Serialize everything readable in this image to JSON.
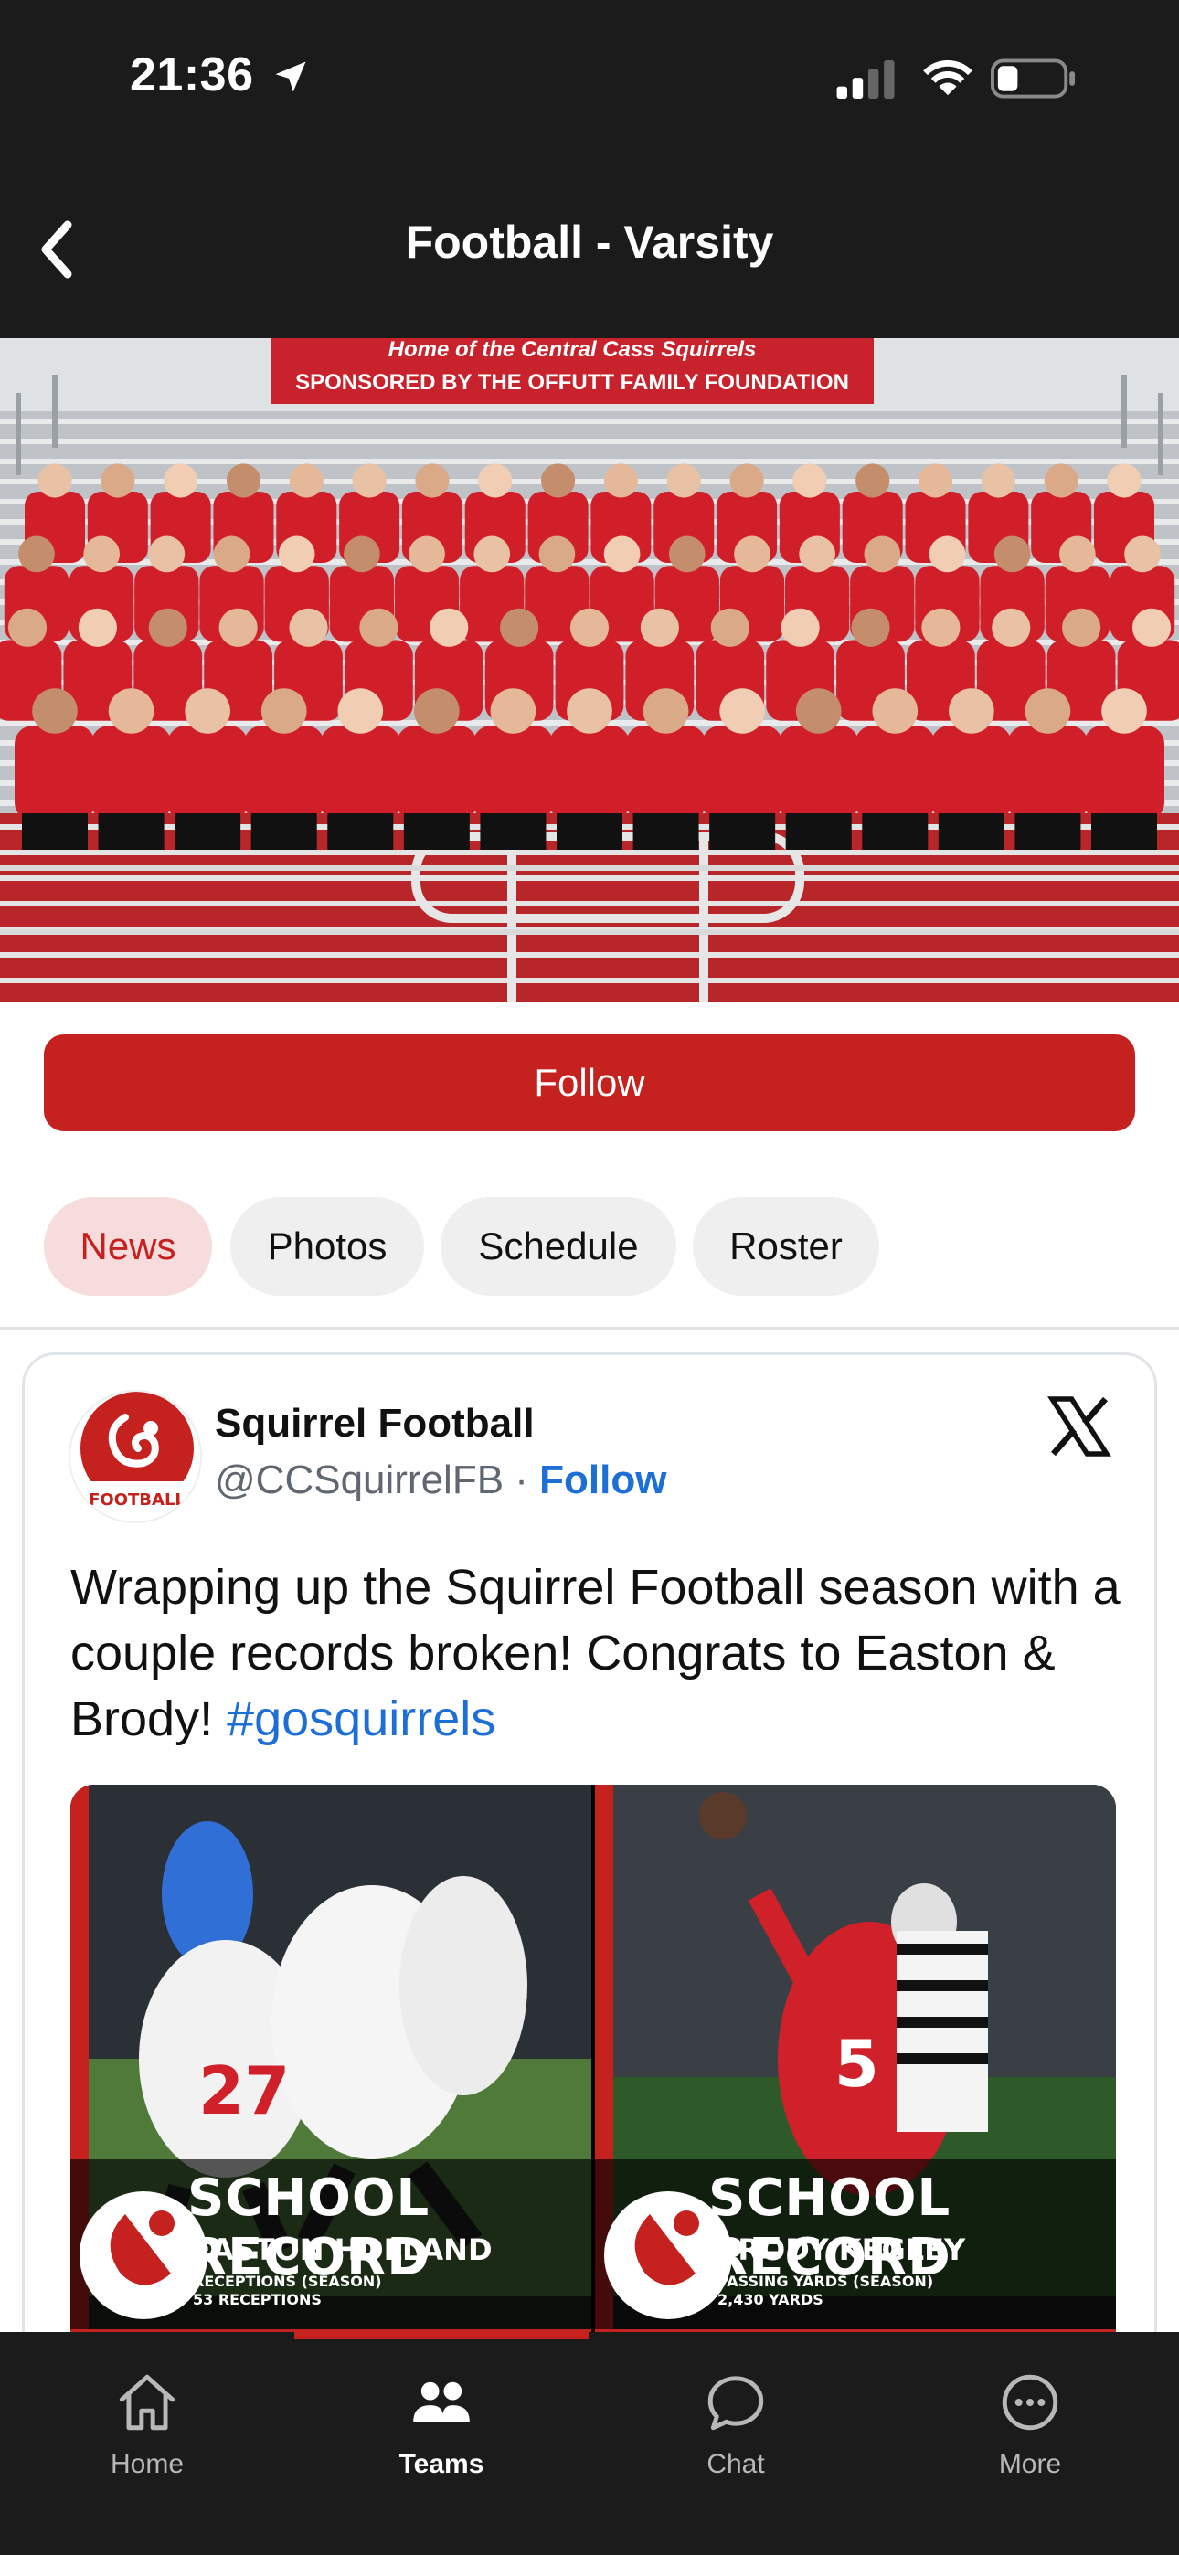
{
  "status_bar": {
    "time": "21:36"
  },
  "header": {
    "title": "Football - Varsity"
  },
  "photo": {
    "banner_line1": "Home of the Central Cass Squirrels",
    "banner_line2": "SPONSORED BY THE OFFUTT FAMILY FOUNDATION"
  },
  "follow_button": {
    "label": "Follow"
  },
  "tabs": [
    {
      "label": "News",
      "active": true
    },
    {
      "label": "Photos",
      "active": false
    },
    {
      "label": "Schedule",
      "active": false
    },
    {
      "label": "Roster",
      "active": false
    }
  ],
  "tweet": {
    "author": "Squirrel Football",
    "handle": "@CCSquirrelFB",
    "separator": " · ",
    "follow_label": "Follow",
    "avatar_text": "FOOTBALL",
    "text": "Wrapping up the Squirrel Football season with a couple records broken! Congrats to Easton & Brody! ",
    "hashtag": "#gosquirrels",
    "media": [
      {
        "title": "SCHOOL RECORD",
        "name": "EASTON HOLLAND",
        "stat_label": "RECEPTIONS (SEASON)",
        "stat_value": "53 RECEPTIONS",
        "jersey": "27"
      },
      {
        "title": "SCHOOL RECORD",
        "name": "BRODY KEGLEY",
        "stat_label": "PASSING YARDS (SEASON)",
        "stat_value": "2,430 YARDS",
        "jersey": "5"
      }
    ]
  },
  "nav": {
    "items": [
      {
        "label": "Home",
        "icon": "home-icon",
        "active": false
      },
      {
        "label": "Teams",
        "icon": "teams-icon",
        "active": true
      },
      {
        "label": "Chat",
        "icon": "chat-icon",
        "active": false
      },
      {
        "label": "More",
        "icon": "more-icon",
        "active": false
      }
    ]
  },
  "colors": {
    "brand_red": "#c4211f",
    "header_bg": "#1b1b1b",
    "link_blue": "#1d6fd6",
    "tab_active_bg": "#f6dcdc",
    "tab_bg": "#efefef"
  }
}
